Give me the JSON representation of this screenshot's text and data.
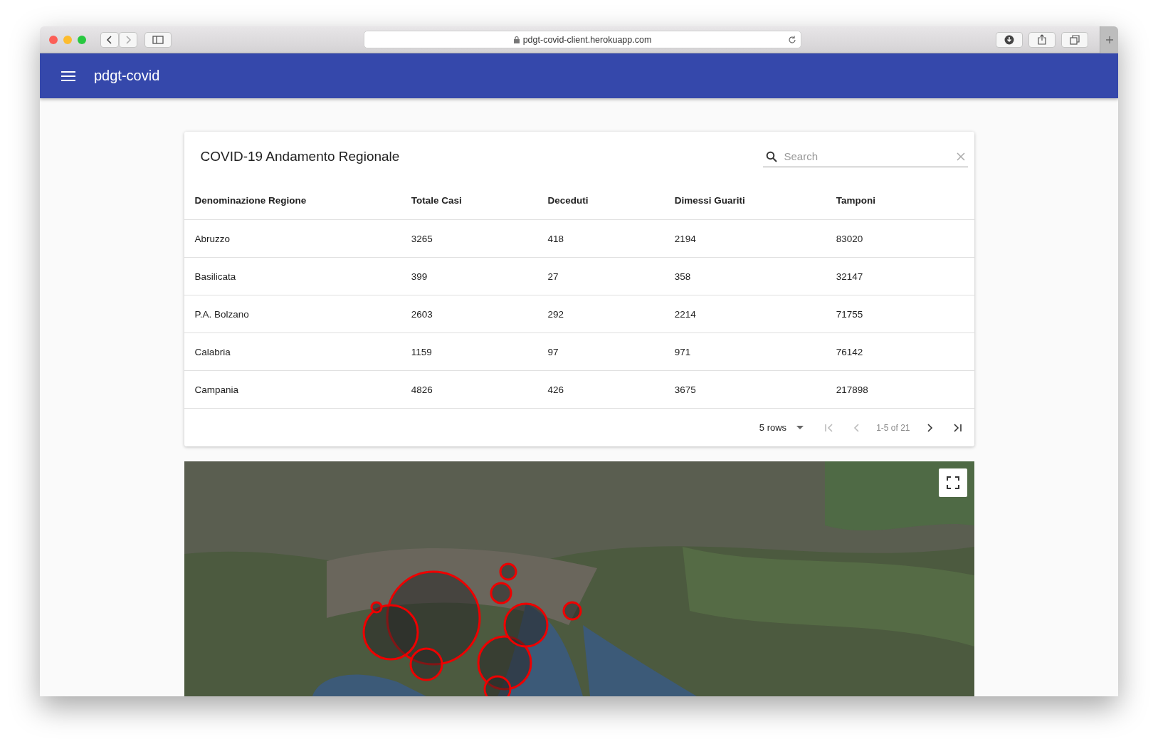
{
  "browser": {
    "url": "pdgt-covid-client.herokuapp.com"
  },
  "app_bar": {
    "title": "pdgt-covid"
  },
  "table": {
    "title": "COVID-19 Andamento Regionale",
    "search": {
      "placeholder": "Search"
    },
    "columns": [
      "Denominazione Regione",
      "Totale Casi",
      "Deceduti",
      "Dimessi Guariti",
      "Tamponi"
    ],
    "rows": [
      [
        "Abruzzo",
        "3265",
        "418",
        "2194",
        "83020"
      ],
      [
        "Basilicata",
        "399",
        "27",
        "358",
        "32147"
      ],
      [
        "P.A. Bolzano",
        "2603",
        "292",
        "2214",
        "71755"
      ],
      [
        "Calabria",
        "1159",
        "97",
        "971",
        "76142"
      ],
      [
        "Campania",
        "4826",
        "426",
        "3675",
        "217898"
      ]
    ],
    "pagination": {
      "rows_per_page": "5 rows",
      "range": "1-5 of 21",
      "first_disabled": true,
      "previous_disabled": true,
      "next_disabled": false,
      "last_disabled": false
    }
  }
}
